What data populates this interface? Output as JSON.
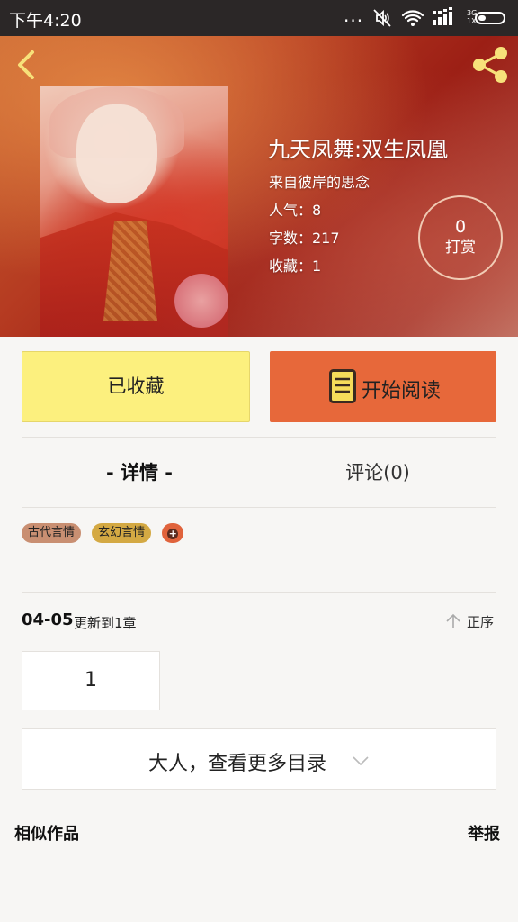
{
  "status_bar": {
    "time": "下午4:20",
    "dots": "...",
    "network_line1": "3G",
    "network_line2": "1X"
  },
  "book": {
    "title": "九天凤舞:双生凤凰",
    "author_line": "来自彼岸的思念",
    "popularity": "人气：8",
    "word_count": "字数：217",
    "favorites": "收藏：1",
    "tip_count": "0",
    "tip_label": "打赏"
  },
  "actions": {
    "collected_label": "已收藏",
    "start_reading_label": "开始阅读"
  },
  "tabs": {
    "detail": "- 详情 -",
    "comments": "评论(0)"
  },
  "tags": [
    "古代言情",
    "玄幻言情"
  ],
  "chapters": {
    "update_date": "04-05",
    "update_text": "更新到1章",
    "sort_label": "正序",
    "first_chapter": "1",
    "more_catalog": "大人，查看更多目录"
  },
  "footer": {
    "similar_works": "相似作品",
    "report": "举报"
  },
  "colors": {
    "collect_button": "#fcf07e",
    "read_button": "#e7683a",
    "tag_ancient": "#c98f72",
    "tag_fantasy": "#d4a943",
    "tag_add": "#e0633c"
  }
}
